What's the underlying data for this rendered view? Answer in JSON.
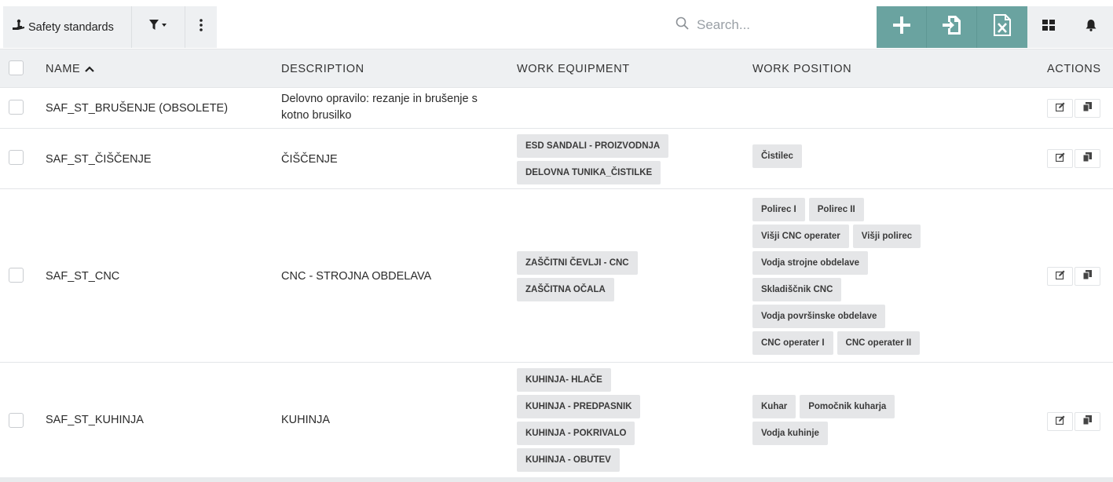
{
  "toolbar": {
    "title": "Safety standards",
    "search_placeholder": "Search..."
  },
  "table": {
    "headers": {
      "name": "NAME",
      "description": "DESCRIPTION",
      "equipment": "WORK EQUIPMENT",
      "position": "WORK POSITION",
      "actions": "ACTIONS"
    },
    "rows": [
      {
        "name": "SAF_ST_BRUŠENJE (OBSOLETE)",
        "description": [
          "Delovno opravilo: rezanje in brušenje s",
          "kotno brusilko"
        ],
        "equipment": [],
        "positions": []
      },
      {
        "name": "SAF_ST_ČIŠČENJE",
        "description": [
          "ČIŠČENJE"
        ],
        "equipment": [
          "ESD SANDALI - PROIZVODNJA",
          "DELOVNA TUNIKA_ČISTILKE"
        ],
        "positions": [
          [
            "Čistilec"
          ]
        ]
      },
      {
        "name": "SAF_ST_CNC",
        "description": [
          "CNC - STROJNA OBDELAVA"
        ],
        "equipment": [
          "ZAŠČITNI ČEVLJI - CNC",
          "ZAŠČITNA OČALA"
        ],
        "positions": [
          [
            "Polirec I",
            "Polirec II"
          ],
          [
            "Višji CNC operater",
            "Višji polirec"
          ],
          [
            "Vodja strojne obdelave"
          ],
          [
            "Skladiščnik CNC"
          ],
          [
            "Vodja površinske obdelave"
          ],
          [
            "CNC operater I",
            "CNC operater II"
          ]
        ]
      },
      {
        "name": "SAF_ST_KUHINJA",
        "description": [
          "KUHINJA"
        ],
        "equipment": [
          "KUHINJA- HLAČE",
          "KUHINJA - PREDPASNIK",
          "KUHINJA - POKRIVALO",
          "KUHINJA - OBUTEV"
        ],
        "positions": [
          [
            "Kuhar",
            "Pomočnik kuharja"
          ],
          [
            "Vodja kuhinje"
          ]
        ]
      }
    ]
  },
  "icons": {
    "title": "hand-icon",
    "filter": "filter-icon",
    "more": "kebab-icon",
    "search": "search-icon",
    "add": "plus-icon",
    "import": "import-icon",
    "excel": "excel-icon",
    "grid": "grid-icon",
    "bell": "bell-icon",
    "edit": "edit-icon",
    "copy": "copy-icon"
  },
  "colors": {
    "accent": "#6aa3a0",
    "header_bg": "#eef0f2",
    "chip_bg": "#e5e6e8"
  }
}
